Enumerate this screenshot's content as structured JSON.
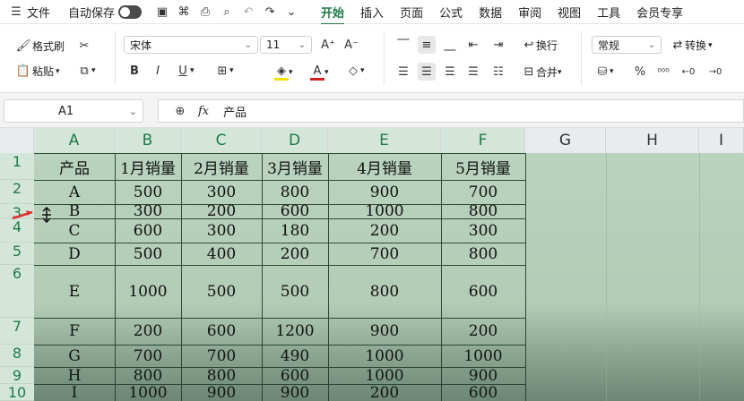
{
  "menubar": {
    "file": "文件",
    "autosave": "自动保存",
    "tabs": [
      "开始",
      "插入",
      "页面",
      "公式",
      "数据",
      "审阅",
      "视图",
      "工具",
      "会员专享"
    ]
  },
  "ribbon": {
    "format_painter": "格式刷",
    "paste": "粘贴",
    "font_name": "宋体",
    "font_size": "11",
    "wrap": "换行",
    "merge": "合并",
    "number_format": "常规",
    "convert": "转换"
  },
  "formula_bar": {
    "cell_ref": "A1",
    "fx": "fx",
    "content": "产品"
  },
  "sheet": {
    "columns": [
      "A",
      "B",
      "C",
      "D",
      "E",
      "F",
      "G",
      "H",
      "I"
    ],
    "rows": [
      "1",
      "2",
      "3",
      "4",
      "5",
      "6",
      "7",
      "8",
      "9",
      "10"
    ],
    "cells": [
      [
        "产品",
        "1月销量",
        "2月销量",
        "3月销量",
        "4月销量",
        "5月销量"
      ],
      [
        "A",
        "500",
        "300",
        "800",
        "900",
        "700"
      ],
      [
        "B",
        "300",
        "200",
        "600",
        "1000",
        "800"
      ],
      [
        "C",
        "600",
        "300",
        "180",
        "200",
        "300"
      ],
      [
        "D",
        "500",
        "400",
        "200",
        "700",
        "800"
      ],
      [
        "E",
        "1000",
        "500",
        "500",
        "800",
        "600"
      ],
      [
        "F",
        "200",
        "600",
        "1200",
        "900",
        "200"
      ],
      [
        "G",
        "700",
        "700",
        "490",
        "1000",
        "1000"
      ],
      [
        "H",
        "800",
        "800",
        "600",
        "1000",
        "900"
      ],
      [
        "I",
        "1000",
        "900",
        "900",
        "200",
        "600"
      ]
    ]
  }
}
